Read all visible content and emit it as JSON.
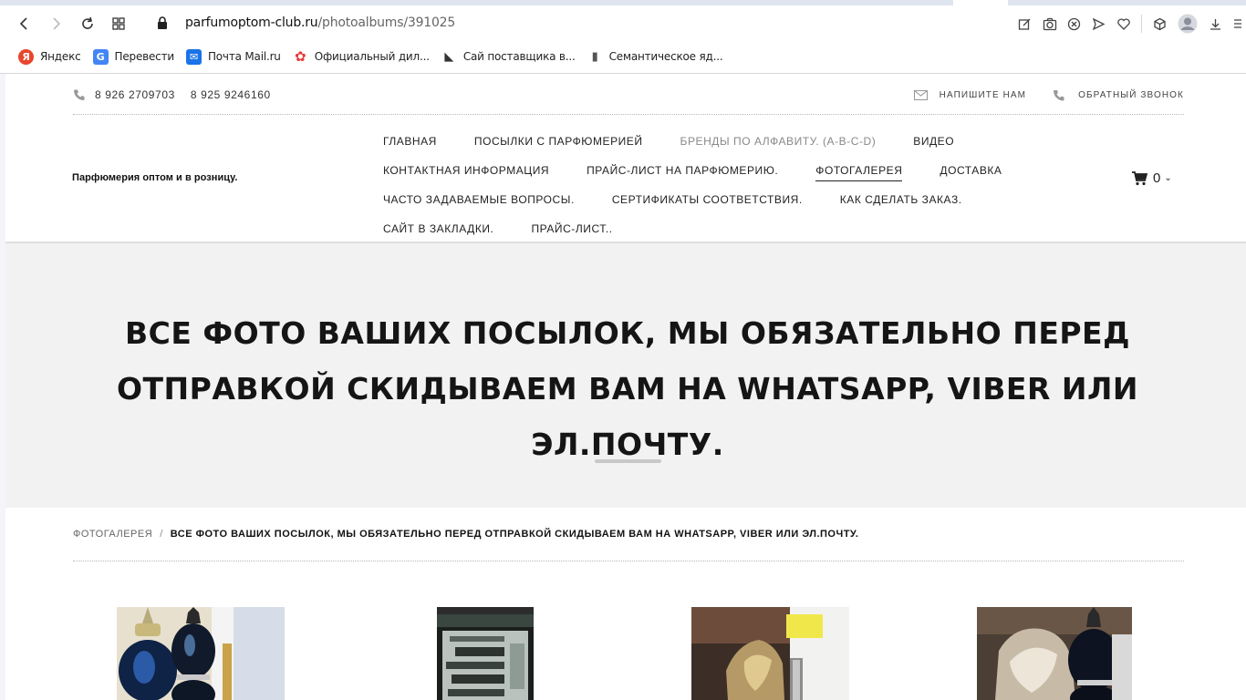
{
  "browser": {
    "url_host": "parfumoptom-club.ru",
    "url_path": "/photoalbums/391025",
    "bookmarks": [
      {
        "label": "Яндекс",
        "icon": "yandex-icon",
        "color": "#e8452c",
        "glyph": "Я"
      },
      {
        "label": "Перевести",
        "icon": "translate-icon",
        "color": "#4285f4",
        "glyph": "G"
      },
      {
        "label": "Почта Mail.ru",
        "icon": "mail-icon",
        "color": "#1a73e8",
        "glyph": "✉"
      },
      {
        "label": "Официальный дил...",
        "icon": "flower-icon",
        "color": "#e53935",
        "glyph": "✿"
      },
      {
        "label": "Сай поставщика в...",
        "icon": "bird-icon",
        "color": "#333333",
        "glyph": "◣"
      },
      {
        "label": "Семантическое яд...",
        "icon": "document-icon",
        "color": "#555555",
        "glyph": "▮"
      }
    ]
  },
  "header": {
    "phones": [
      "8 926 2709703",
      "8 925 9246160"
    ],
    "write_us": "НАПИШИТЕ НАМ",
    "callback": "ОБРАТНЫЙ ЗВОНОК",
    "logo_text": "Парфюмерия оптом и в розницу.",
    "cart_count": "0",
    "nav": [
      [
        {
          "label": "ГЛАВНАЯ",
          "state": "normal"
        },
        {
          "label": "ПОСЫЛКИ С ПАРФЮМЕРИЕЙ",
          "state": "normal"
        },
        {
          "label": "БРЕНДЫ ПО АЛФАВИТУ. (A-B-C-D)",
          "state": "muted"
        },
        {
          "label": "ВИДЕО",
          "state": "normal"
        }
      ],
      [
        {
          "label": "КОНТАКТНАЯ ИНФОРМАЦИЯ",
          "state": "normal"
        },
        {
          "label": "ПРАЙС-ЛИСТ НА ПАРФЮМЕРИЮ.",
          "state": "normal"
        },
        {
          "label": "ФОТОГАЛЕРЕЯ",
          "state": "active"
        },
        {
          "label": "ДОСТАВКА",
          "state": "normal"
        }
      ],
      [
        {
          "label": "ЧАСТО ЗАДАВАЕМЫЕ ВОПРОСЫ.",
          "state": "normal"
        },
        {
          "label": "СЕРТИФИКАТЫ СООТВЕТСТВИЯ.",
          "state": "normal"
        },
        {
          "label": "КАК СДЕЛАТЬ ЗАКАЗ.",
          "state": "normal"
        }
      ],
      [
        {
          "label": "САЙТ В ЗАКЛАДКИ.",
          "state": "normal"
        },
        {
          "label": "ПРАЙС-ЛИСТ..",
          "state": "normal"
        }
      ]
    ]
  },
  "hero": {
    "title": "ВСЕ ФОТО ВАШИХ ПОСЫЛОК, МЫ ОБЯЗАТЕЛЬНО ПЕРЕД ОТПРАВКОЙ СКИДЫВАЕМ ВАМ НА WHATSAPP, VIBER ИЛИ ЭЛ.ПОЧТУ."
  },
  "breadcrumb": {
    "parent": "ФОТОГАЛЕРЕЯ",
    "separator": "/",
    "current": "ВСЕ ФОТО ВАШИХ ПОСЫЛОК, МЫ ОБЯЗАТЕЛЬНО ПЕРЕД ОТПРАВКОЙ СКИДЫВАЕМ ВАМ НА WHATSAPP, VIBER ИЛИ ЭЛ.ПОЧТУ."
  },
  "colors": {
    "accent": "#222222",
    "hero_bg": "#f2f2f2",
    "muted_link": "#888888"
  }
}
